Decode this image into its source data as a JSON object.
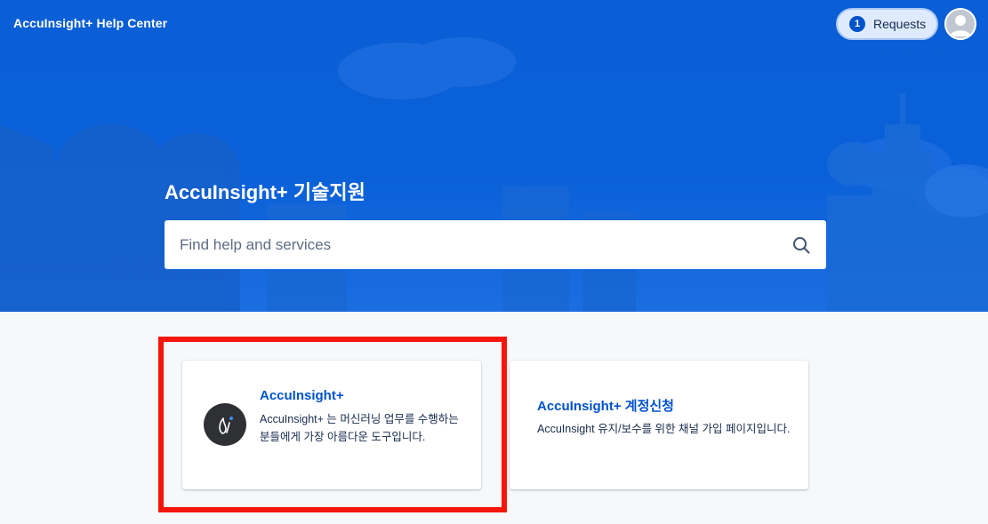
{
  "header": {
    "brand": "AccuInsight+ Help Center",
    "requests_count": "1",
    "requests_label": "Requests"
  },
  "hero": {
    "title": "AccuInsight+ 기술지원",
    "search_placeholder": "Find help and services"
  },
  "cards": [
    {
      "title": "AccuInsight+",
      "description": "AccuInsight+ 는 머신러닝 업무를 수행하는 분들에게 가장 아름다운 도구입니다.",
      "icon": "accuinsight-logo-icon"
    },
    {
      "title": "AccuInsight+ 계정신청",
      "description": "AccuInsight 유지/보수를 위한 채널 가입 페이지입니다."
    }
  ],
  "colors": {
    "hero_blue": "#0b5fd6",
    "link_blue": "#0052cc",
    "highlight_red": "#f5160a",
    "page_bg": "#f7f8f9"
  }
}
